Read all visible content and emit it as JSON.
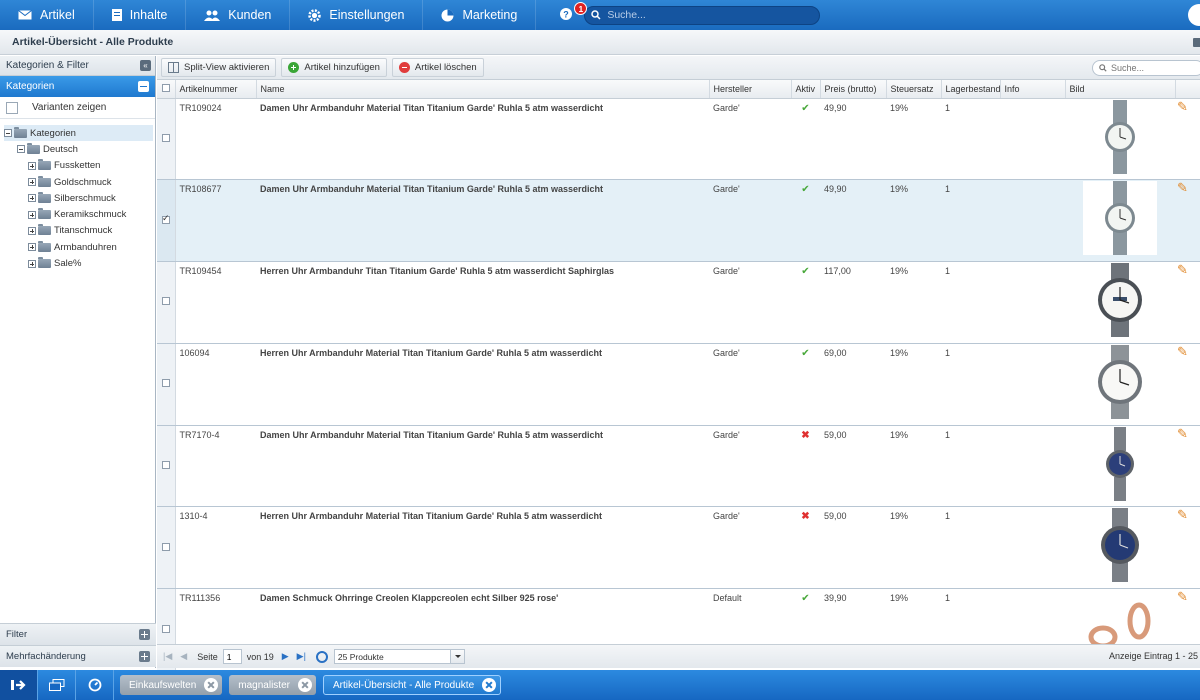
{
  "nav": {
    "items": [
      {
        "label": "Artikel",
        "icon": "envelope-icon"
      },
      {
        "label": "Inhalte",
        "icon": "document-icon"
      },
      {
        "label": "Kunden",
        "icon": "users-icon"
      },
      {
        "label": "Einstellungen",
        "icon": "gear-icon"
      },
      {
        "label": "Marketing",
        "icon": "pie-chart-icon"
      }
    ],
    "help_badge": "1",
    "search_placeholder": "Suche..."
  },
  "window": {
    "title": "Artikel-Übersicht - Alle Produkte"
  },
  "sidebar": {
    "header": "Kategorien & Filter",
    "active_panel": "Kategorien",
    "variants_label": "Varianten zeigen",
    "tree_root": "Kategorien",
    "tree_lang": "Deutsch",
    "categories": [
      "Fussketten",
      "Goldschmuck",
      "Silberschmuck",
      "Keramikschmuck",
      "Titanschmuck",
      "Armbanduhren",
      "Sale%"
    ],
    "filter_label": "Filter",
    "mass_edit_label": "Mehrfachänderung"
  },
  "toolbar": {
    "split_view": "Split-View aktivieren",
    "add": "Artikel hinzufügen",
    "delete": "Artikel löschen",
    "search_placeholder": "Suche..."
  },
  "columns": [
    "Artikelnummer",
    "Name",
    "Hersteller",
    "Aktiv",
    "Preis (brutto)",
    "Steuersatz",
    "Lagerbestand",
    "Info",
    "Bild"
  ],
  "rows": [
    {
      "sku": "TR109024",
      "name": "Damen Uhr Armbanduhr Material Titan Titanium Garde' Ruhla 5 atm wasserdicht",
      "maker": "Garde'",
      "active": true,
      "price": "49,90",
      "tax": "19%",
      "stock": "1",
      "image": "ladies-watch-silver"
    },
    {
      "sku": "TR108677",
      "name": "Damen Uhr Armbanduhr Material Titan Titanium Garde' Ruhla 5 atm wasserdicht",
      "maker": "Garde'",
      "active": true,
      "price": "49,90",
      "tax": "19%",
      "stock": "1",
      "image": "ladies-watch-silver"
    },
    {
      "sku": "TR109454",
      "name": "Herren Uhr Armbanduhr Titan Titanium Garde' Ruhla 5 atm wasserdicht Saphirglas",
      "maker": "Garde'",
      "active": true,
      "price": "117,00",
      "tax": "19%",
      "stock": "1",
      "image": "mens-watch-dark"
    },
    {
      "sku": "106094",
      "name": "Herren Uhr Armbanduhr Material Titan Titanium Garde' Ruhla 5 atm wasserdicht",
      "maker": "Garde'",
      "active": true,
      "price": "69,00",
      "tax": "19%",
      "stock": "1",
      "image": "mens-watch-white"
    },
    {
      "sku": "TR7170-4",
      "name": "Damen Uhr Armbanduhr Material Titan Titanium Garde' Ruhla 5 atm wasserdicht",
      "maker": "Garde'",
      "active": false,
      "price": "59,00",
      "tax": "19%",
      "stock": "1",
      "image": "ladies-watch-blue"
    },
    {
      "sku": "1310-4",
      "name": "Herren Uhr Armbanduhr Material Titan Titanium Garde' Ruhla 5 atm wasserdicht",
      "maker": "Garde'",
      "active": false,
      "price": "59,00",
      "tax": "19%",
      "stock": "1",
      "image": "mens-watch-blue"
    },
    {
      "sku": "TR111356",
      "name": "Damen Schmuck Ohrringe Creolen Klappcreolen echt Silber 925 rose'",
      "maker": "Default",
      "active": true,
      "price": "39,90",
      "tax": "19%",
      "stock": "1",
      "image": "rose-earrings"
    }
  ],
  "selected_row": 1,
  "pager": {
    "page_label": "Seite",
    "page": "1",
    "of_label": "von 19",
    "per_page": "25 Produkte",
    "info": "Anzeige Eintrag 1 - 25"
  },
  "taskbar": {
    "tabs": [
      {
        "label": "Einkaufswelten",
        "active": false
      },
      {
        "label": "magnalister",
        "active": false
      },
      {
        "label": "Artikel-Übersicht - Alle Produkte",
        "active": true
      }
    ]
  },
  "colors": {
    "accent": "#1f79cf",
    "active_check": "#48a83a",
    "inactive_x": "#e03030"
  }
}
